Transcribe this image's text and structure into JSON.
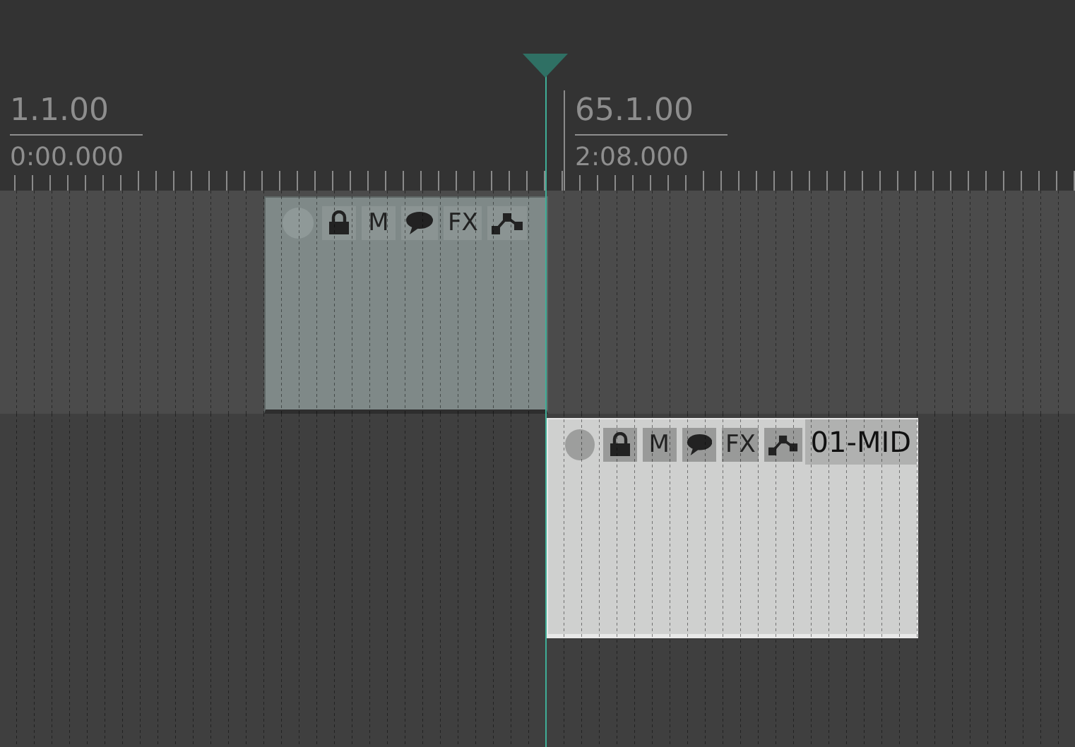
{
  "ruler": {
    "markers": [
      {
        "bar": "1.1.00",
        "time": "0:00.000"
      },
      {
        "bar": "65.1.00",
        "time": "2:08.000"
      }
    ]
  },
  "tracks": [
    {
      "items": [
        {
          "selected": false,
          "buttons": [
            "M",
            "FX"
          ]
        }
      ]
    },
    {
      "items": [
        {
          "selected": true,
          "buttons": [
            "M",
            "FX"
          ],
          "name": "01-MID"
        }
      ]
    }
  ]
}
